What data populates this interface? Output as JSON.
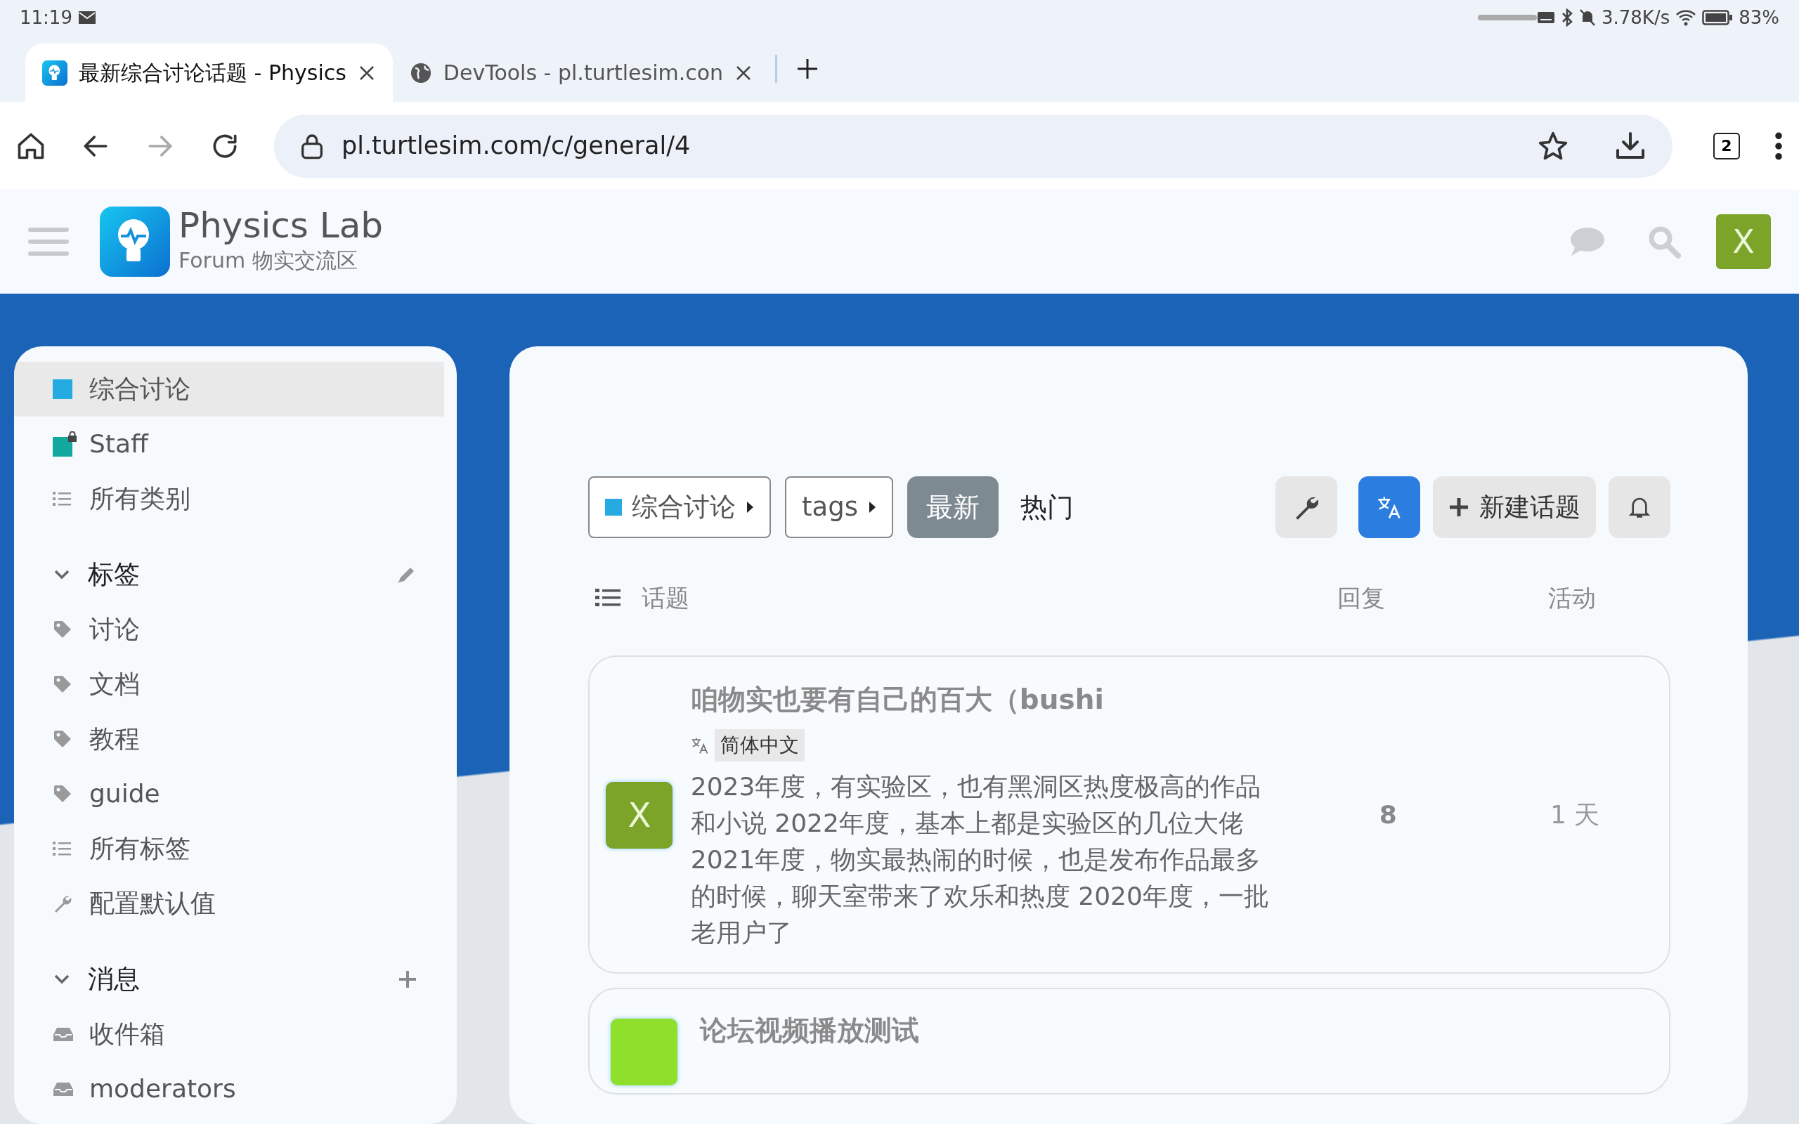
{
  "status_bar": {
    "time": "11:19",
    "net_speed": "3.78K/s",
    "battery": "83%"
  },
  "browser": {
    "tabs": [
      {
        "title": "最新综合讨论话题 - Physics",
        "selected": true
      },
      {
        "title": "DevTools - pl.turtlesim.con",
        "selected": false
      }
    ],
    "tab_count": "2",
    "url": "pl.turtlesim.com/c/general/4"
  },
  "header": {
    "site_name": "Physics Lab",
    "site_subtitle": "Forum 物实交流区",
    "avatar_letter": "X"
  },
  "sidebar": {
    "groups": [
      {
        "items": [
          {
            "kind": "category",
            "label": "综合讨论",
            "color": "#25aae1",
            "selected": true
          },
          {
            "kind": "locked-category",
            "label": "Staff",
            "color": "#12a89d",
            "selected": false
          },
          {
            "kind": "list",
            "label": "所有类别",
            "selected": false
          }
        ]
      },
      {
        "header": "标签",
        "expanded": true,
        "kind": "editable",
        "items": [
          {
            "kind": "tag",
            "label": "讨论",
            "selected": false
          },
          {
            "kind": "tag",
            "label": "文档",
            "selected": false
          },
          {
            "kind": "tag",
            "label": "教程",
            "selected": false
          },
          {
            "kind": "tag",
            "label": "guide",
            "selected": false
          },
          {
            "kind": "list",
            "label": "所有标签",
            "selected": false
          },
          {
            "kind": "wrench",
            "label": "配置默认值",
            "selected": false
          }
        ]
      },
      {
        "header": "消息",
        "expanded": true,
        "kind": "addable",
        "items": [
          {
            "kind": "inbox",
            "label": "收件箱",
            "selected": false
          },
          {
            "kind": "inbox",
            "label": "moderators",
            "selected": false
          }
        ]
      }
    ]
  },
  "main": {
    "filters": [
      {
        "label": "综合讨论",
        "color": "#25aae1"
      },
      {
        "label": "tags"
      }
    ],
    "nav": [
      {
        "label": "最新",
        "selected": true
      },
      {
        "label": "热门",
        "selected": false
      }
    ],
    "actions": [
      {
        "kind": "wrench",
        "on": false
      },
      {
        "kind": "translate",
        "on": true
      },
      {
        "kind": "new",
        "label": "新建话题",
        "on": false
      },
      {
        "kind": "bell",
        "on": false
      }
    ],
    "columns": [
      "话题",
      "回复",
      "活动"
    ],
    "topics": [
      {
        "title": "咱物实也要有自己的百大（bushi",
        "language": "简体中文",
        "excerpt": "2023年度，有实验区，也有黑洞区热度极高的作品和小说 2022年度，基本上都是实验区的几位大佬 2021年度，物实最热闹的时候，也是发布作品最多的时候，聊天室带来了欢乐和热度 2020年度，一批老用户了",
        "avatar_letter": "X",
        "color": "#7ba428",
        "replies": "8",
        "activity": "1 天"
      },
      {
        "title": "论坛视频播放测试",
        "color": "#8ee02a"
      }
    ]
  }
}
